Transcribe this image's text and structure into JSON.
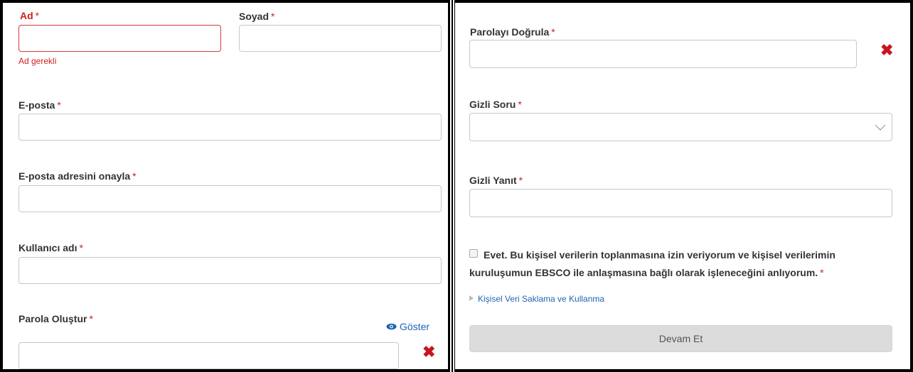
{
  "left": {
    "first_name": {
      "label": "Ad",
      "required": "*",
      "value": "",
      "error": "Ad gerekli"
    },
    "last_name": {
      "label": "Soyad",
      "required": "*",
      "value": ""
    },
    "email": {
      "label": "E-posta",
      "required": "*",
      "value": ""
    },
    "confirm_email": {
      "label": "E-posta adresini onayla",
      "required": "*",
      "value": ""
    },
    "username": {
      "label": "Kullanıcı adı",
      "required": "*",
      "value": ""
    },
    "password": {
      "label": "Parola Oluştur",
      "required": "*",
      "value": "",
      "show_label": "Göster",
      "status": "✖"
    }
  },
  "right": {
    "confirm_password": {
      "label": "Parolayı Doğrula",
      "required": "*",
      "value": "",
      "status": "✖"
    },
    "secret_question": {
      "label": "Gizli Soru",
      "required": "*",
      "selected": ""
    },
    "secret_answer": {
      "label": "Gizli Yanıt",
      "required": "*",
      "value": ""
    },
    "consent": {
      "text": "Evet. Bu kişisel verilerin toplanmasına izin veriyorum ve kişisel verilerimin kuruluşumun EBSCO ile anlaşmasına bağlı olarak işleneceğini anlıyorum.",
      "required": "*"
    },
    "privacy_link": "Kişisel Veri Saklama ve Kullanma",
    "continue_label": "Devam Et"
  },
  "colors": {
    "error": "#cc1f1f",
    "link": "#1f64b5",
    "x_mark": "#c9141d",
    "button_bg": "#dcdcdc"
  },
  "icons": {
    "show_password": "eye-icon",
    "status": "x-mark-icon",
    "select": "chevron-down-icon",
    "disclosure": "triangle-right-icon"
  }
}
